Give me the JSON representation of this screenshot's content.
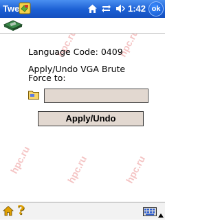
{
  "titlebar": {
    "app_title": "Twe",
    "clock": "1:42",
    "ok_label": "ok"
  },
  "content": {
    "language_code_line": "Language Code: 0409",
    "apply_line1": "Apply/Undo VGA Brute",
    "apply_line2": "Force to:",
    "path_value": "",
    "apply_button_label": "Apply/Undo"
  },
  "icons": {
    "app": "app-icon",
    "home": "home-icon",
    "connectivity": "connectivity-icon",
    "volume": "volume-icon",
    "settings": "settings-icon",
    "folder": "folder-icon",
    "home_bottom": "home-icon",
    "help": "help-icon",
    "keyboard": "keyboard-icon",
    "arrow_up": "arrow-up-icon"
  },
  "watermark": "hpc.ru"
}
